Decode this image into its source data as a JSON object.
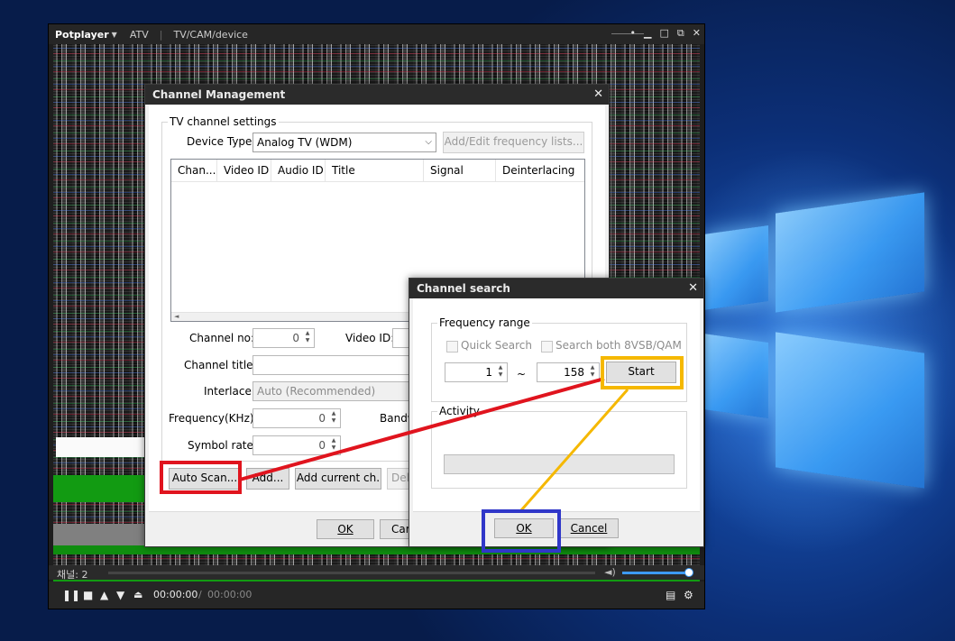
{
  "player": {
    "app_name": "Potplayer",
    "mode": "ATV",
    "source": "TV/CAM/device",
    "channel_status": "채널: 2",
    "time_current": "00:00:00",
    "time_separator": "/",
    "time_total": "00:00:00",
    "icons": [
      "pause-icon",
      "stop-icon",
      "prev-icon",
      "next-icon",
      "eject-icon",
      "volume-icon",
      "playlist-icon",
      "settings-icon",
      "minimize-icon",
      "maximize-icon",
      "close-icon"
    ]
  },
  "channel_management": {
    "title": "Channel Management",
    "group_label": "TV channel settings",
    "device_type_label": "Device Type:",
    "device_type_value": "Analog TV (WDM)",
    "freq_list_button": "Add/Edit frequency lists...",
    "columns": [
      "Chan...",
      "Video ID",
      "Audio ID",
      "Title",
      "Signal",
      "Deinterlacing"
    ],
    "channel_no_label": "Channel no:",
    "channel_no_value": "0",
    "video_id_label": "Video ID:",
    "channel_title_label": "Channel title:",
    "interlace_label": "Interlace:",
    "interlace_value": "Auto (Recommended)",
    "frequency_label": "Frequency(KHz):",
    "frequency_value": "0",
    "bandwidth_label": "Bandw",
    "symbol_rate_label": "Symbol rate:",
    "symbol_rate_value": "0",
    "auto_scan_button": "Auto Scan...",
    "add_button": "Add...",
    "add_current_button": "Add current ch.",
    "delete_button": "Dele",
    "ok_button": "OK",
    "cancel_button": "Car"
  },
  "channel_search": {
    "title": "Channel search",
    "frequency_group": "Frequency range",
    "quick_search_label": "Quick Search",
    "search_both_label": "Search both 8VSB/QAM",
    "range_from": "1",
    "range_separator": "~",
    "range_to": "158",
    "start_button": "Start",
    "activity_group": "Activity",
    "ok_button": "OK",
    "cancel_button": "Cancel"
  },
  "annotations": {
    "red": "#e0141e",
    "yellow": "#f5b800",
    "blue": "#3037c9"
  }
}
